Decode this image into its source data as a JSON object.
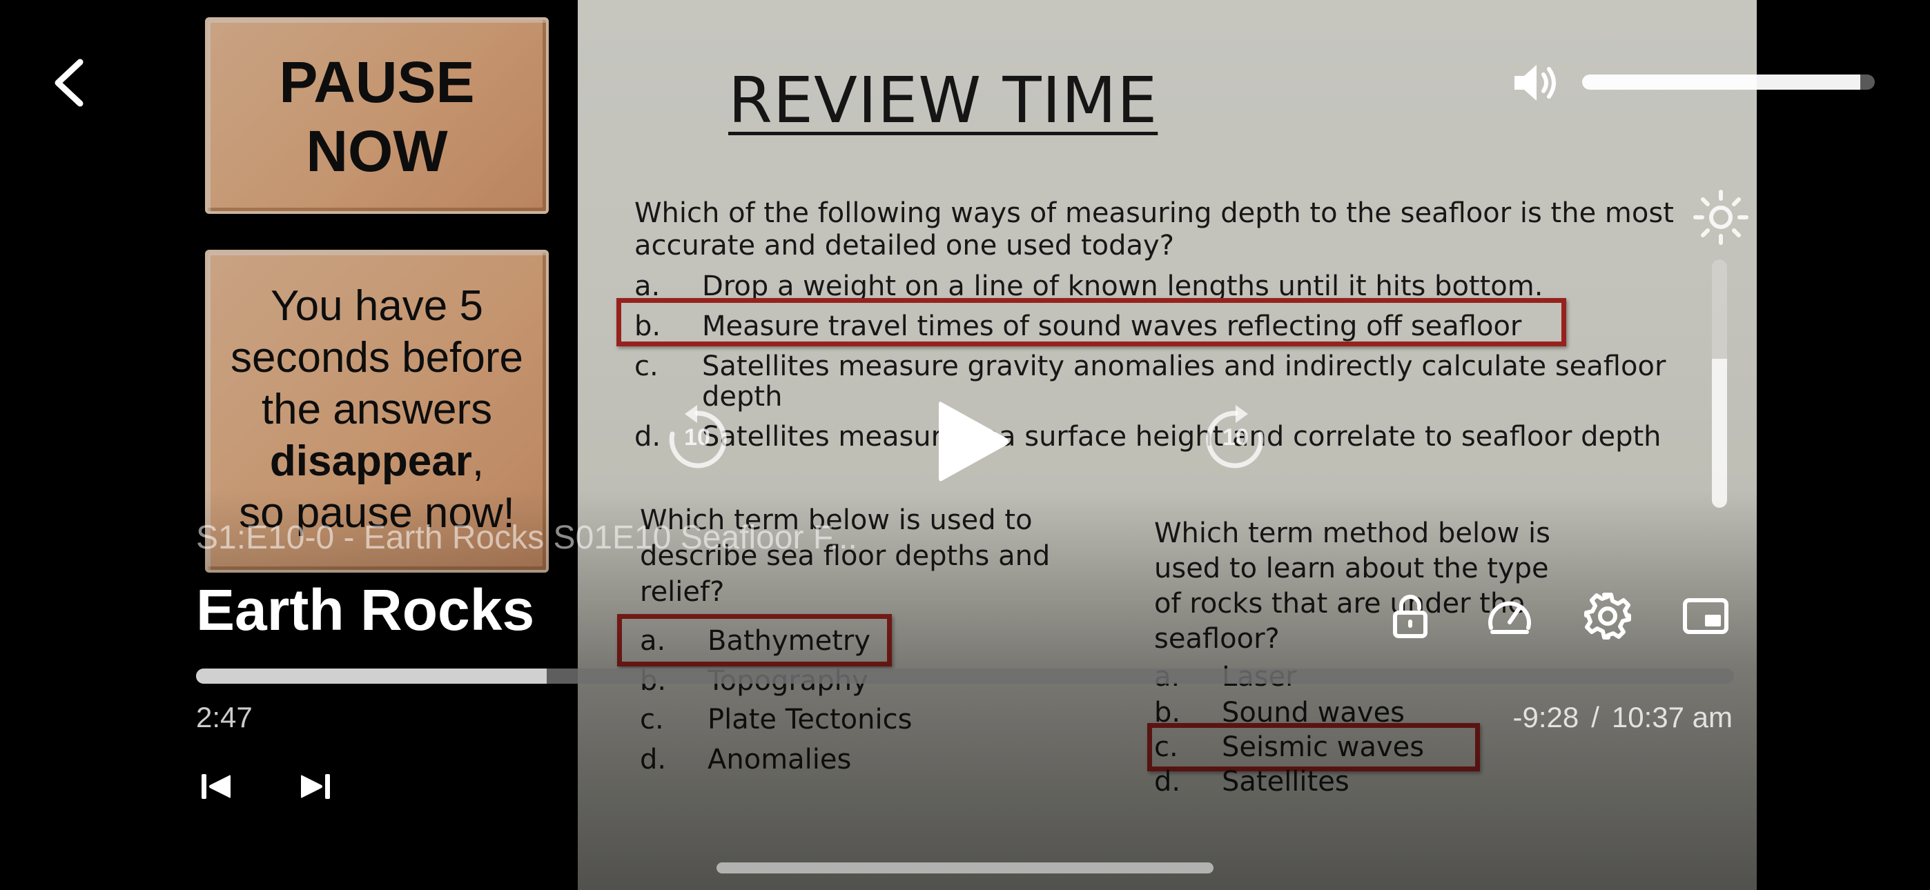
{
  "slide": {
    "left_pane": {
      "pause_line1": "PAUSE",
      "pause_line2": "NOW",
      "warn_line1": "You have 5",
      "warn_line2": "seconds before",
      "warn_line3": "the answers",
      "warn_bold": "disappear",
      "warn_comma": ",",
      "warn_line5": "so pause now!"
    },
    "title": "REVIEW TIME",
    "question1": {
      "text": "Which of the following ways of measuring depth to the seafloor is the most accurate and detailed one used today?",
      "options": [
        {
          "letter": "a.",
          "text": "Drop a weight on a line of known lengths until it hits bottom."
        },
        {
          "letter": "b.",
          "text": "Measure travel times of sound waves reflecting off seafloor"
        },
        {
          "letter": "c.",
          "text": "Satellites measure gravity anomalies and indirectly calculate seafloor"
        },
        {
          "letter": "",
          "text": "depth"
        },
        {
          "letter": "d.",
          "text": "Satellites measure sea surface height and correlate to seafloor depth"
        }
      ]
    },
    "question2": {
      "text": "Which term below is used to describe sea floor depths and relief?",
      "options": [
        {
          "letter": "a.",
          "text": "Bathymetry"
        },
        {
          "letter": "b.",
          "text": "Topography"
        },
        {
          "letter": "c.",
          "text": "Plate Tectonics"
        },
        {
          "letter": "d.",
          "text": "Anomalies"
        }
      ]
    },
    "question3": {
      "text": "Which term method below is used to learn about the type of rocks that are under the seafloor?",
      "options": [
        {
          "letter": "a.",
          "text": "Laser"
        },
        {
          "letter": "b.",
          "text": "Sound waves"
        },
        {
          "letter": "c.",
          "text": "Seismic waves"
        },
        {
          "letter": "d.",
          "text": "Satellites"
        }
      ]
    },
    "highlight_color": "#b72a24"
  },
  "player": {
    "episode_subtitle": "S1:E10-0 - Earth Rocks S01E10 Seafloor F...",
    "show_title": "Earth Rocks",
    "time_elapsed": "2:47",
    "time_remaining": "-9:28",
    "separator": "/",
    "clock": "10:37 am",
    "progress_fraction": 0.228,
    "volume_fraction": 0.95,
    "brightness_fraction": 0.6,
    "skip_back_seconds": "10",
    "skip_forward_seconds": "10",
    "icons": {
      "back": "chevron-left-icon",
      "volume": "speaker-icon",
      "brightness": "sun-icon",
      "rewind": "rewind-10-icon",
      "play": "play-icon",
      "forward": "forward-10-icon",
      "lock": "lock-icon",
      "speed": "speedometer-icon",
      "settings": "gear-icon",
      "pip": "picture-in-picture-icon",
      "previous": "skip-previous-icon",
      "next": "skip-next-icon"
    }
  }
}
